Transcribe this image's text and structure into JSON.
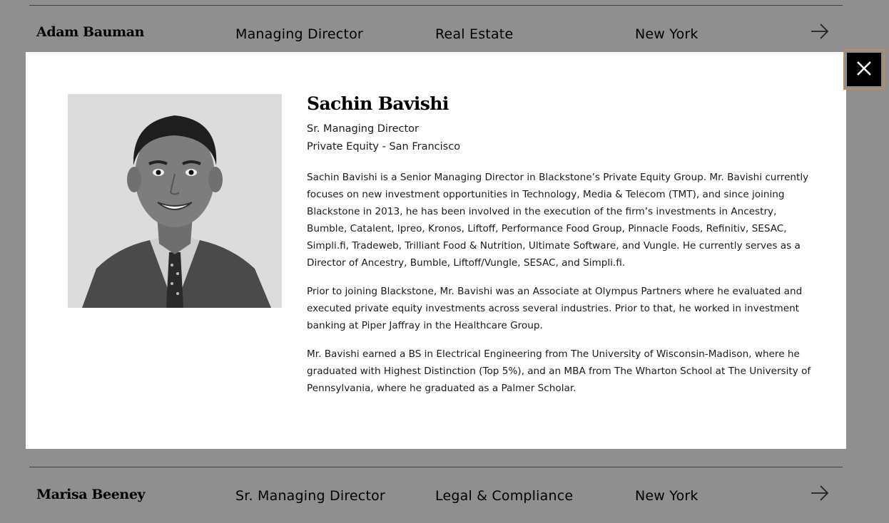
{
  "directory": {
    "rows": [
      {
        "name": "Adam Bauman",
        "title": "Managing Director",
        "group": "Real Estate",
        "city": "New York",
        "arrow_icon": "arrow-right-icon"
      },
      {
        "name": "Marisa Beeney",
        "title": "Sr. Managing Director",
        "group": "Legal & Compliance",
        "city": "New York",
        "arrow_icon": "arrow-right-icon"
      }
    ]
  },
  "modal": {
    "name": "Sachin Bavishi",
    "title": "Sr. Managing Director",
    "department": "Private Equity - San Francisco",
    "bio": [
      "Sachin Bavishi is a Senior Managing Director in Blackstone’s Private Equity Group. Mr. Bavishi currently focuses on new investment opportunities in Technology, Media & Telecom (TMT), and since joining Blackstone in 2013, he has been involved in the execution of the firm’s investments in Ancestry, Bumble, Catalent, Ipreo, Kronos, Liftoff, Performance Food Group, Pinnacle Foods, Refinitiv, SESAC, Simpli.fi, Tradeweb, Trilliant Food & Nutrition, Ultimate Software, and Vungle. He currently serves as a Director of Ancestry, Bumble, Liftoff/Vungle, SESAC, and Simpli.fi.",
      "Prior to joining Blackstone, Mr. Bavishi was an Associate at Olympus Partners where he evaluated and executed private equity investments across several industries. Prior to that, he worked in investment banking at Piper Jaffray in the Healthcare Group.",
      "Mr. Bavishi earned a BS in Electrical Engineering from The University of Wisconsin-Madison, where he graduated with Highest Distinction (Top 5%), and an MBA from The Wharton School at The University of Pennsylvania, where he graduated as a Palmer Scholar."
    ],
    "close_icon": "close-icon"
  },
  "colors": {
    "overlay": "#8f8f8f",
    "modal_bg": "#ffffff",
    "close_bg": "#000000",
    "close_focus_ring": "#b98c60"
  }
}
